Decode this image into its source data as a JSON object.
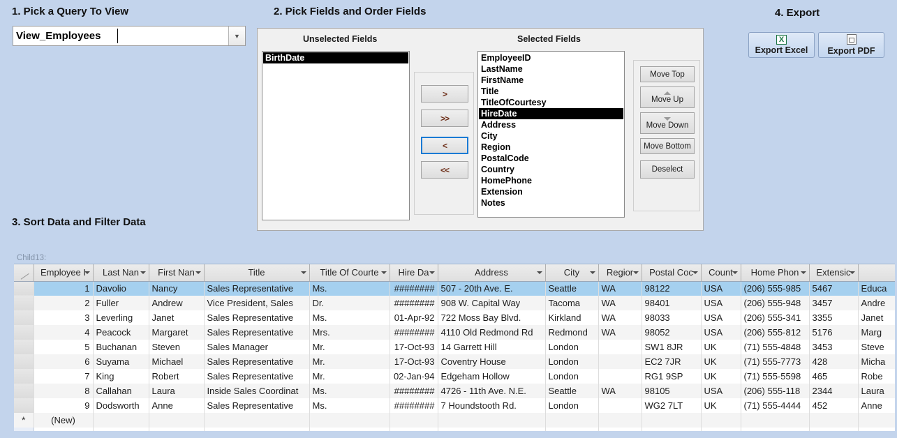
{
  "sections": {
    "step1": "1. Pick a Query To View",
    "step2": "2. Pick Fields and Order Fields",
    "step3": "3. Sort Data and Filter Data",
    "step4": "4. Export"
  },
  "query_combo": {
    "value": "View_Employees",
    "placeholder": "",
    "arrow_icon": "chevron-down-icon"
  },
  "fields": {
    "unselected_label": "Unselected Fields",
    "selected_label": "Selected Fields",
    "unselected": [
      {
        "label": "BirthDate",
        "selected": true
      }
    ],
    "selected": [
      {
        "label": "EmployeeID",
        "selected": false
      },
      {
        "label": "LastName",
        "selected": false
      },
      {
        "label": "FirstName",
        "selected": false
      },
      {
        "label": "Title",
        "selected": false
      },
      {
        "label": "TitleOfCourtesy",
        "selected": false
      },
      {
        "label": "HireDate",
        "selected": true
      },
      {
        "label": "Address",
        "selected": false
      },
      {
        "label": "City",
        "selected": false
      },
      {
        "label": "Region",
        "selected": false
      },
      {
        "label": "PostalCode",
        "selected": false
      },
      {
        "label": "Country",
        "selected": false
      },
      {
        "label": "HomePhone",
        "selected": false
      },
      {
        "label": "Extension",
        "selected": false
      },
      {
        "label": "Notes",
        "selected": false
      }
    ],
    "transfer_buttons": {
      "move_right_one": ">",
      "move_right_all": ">>",
      "move_left_one": "<",
      "move_left_all": "<<",
      "focused": "<"
    },
    "order_buttons": {
      "move_top": "Move Top",
      "move_up": "Move Up",
      "move_down": "Move Down",
      "move_bottom": "Move Bottom",
      "deselect": "Deselect"
    }
  },
  "export": {
    "excel_label": "Export Excel",
    "excel_icon": "excel-file-icon",
    "excel_icon_glyph": "X",
    "pdf_label": "Export PDF",
    "pdf_icon": "pdf-file-icon"
  },
  "datasheet": {
    "child_label": "Child13:",
    "new_record_label": "(New)",
    "new_record_icon": "asterisk-icon",
    "columns": [
      "Employee I",
      "Last Nan",
      "First Nan",
      "Title",
      "Title Of Courte",
      "Hire Da",
      "Address",
      "City",
      "Regior",
      "Postal Coc",
      "Count",
      "Home Phon",
      "Extensic",
      ""
    ],
    "rows": [
      {
        "selected": true,
        "id": "1",
        "last": "Davolio",
        "first": "Nancy",
        "title": "Sales Representative",
        "courtesy": "Ms.",
        "hire": "########",
        "address": "507 - 20th Ave. E.",
        "city": "Seattle",
        "region": "WA",
        "postal": "98122",
        "country": "USA",
        "phone": "(206) 555-985",
        "ext": "5467",
        "notes": "Educa"
      },
      {
        "selected": false,
        "id": "2",
        "last": "Fuller",
        "first": "Andrew",
        "title": "Vice President, Sales",
        "courtesy": "Dr.",
        "hire": "########",
        "address": "908 W. Capital Way",
        "city": "Tacoma",
        "region": "WA",
        "postal": "98401",
        "country": "USA",
        "phone": "(206) 555-948",
        "ext": "3457",
        "notes": "Andre"
      },
      {
        "selected": false,
        "id": "3",
        "last": "Leverling",
        "first": "Janet",
        "title": "Sales Representative",
        "courtesy": "Ms.",
        "hire": "01-Apr-92",
        "address": "722 Moss Bay Blvd.",
        "city": "Kirkland",
        "region": "WA",
        "postal": "98033",
        "country": "USA",
        "phone": "(206) 555-341",
        "ext": "3355",
        "notes": "Janet"
      },
      {
        "selected": false,
        "id": "4",
        "last": "Peacock",
        "first": "Margaret",
        "title": "Sales Representative",
        "courtesy": "Mrs.",
        "hire": "########",
        "address": "4110 Old Redmond Rd",
        "city": "Redmond",
        "region": "WA",
        "postal": "98052",
        "country": "USA",
        "phone": "(206) 555-812",
        "ext": "5176",
        "notes": "Marg"
      },
      {
        "selected": false,
        "id": "5",
        "last": "Buchanan",
        "first": "Steven",
        "title": "Sales Manager",
        "courtesy": "Mr.",
        "hire": "17-Oct-93",
        "address": "14 Garrett Hill",
        "city": "London",
        "region": "",
        "postal": "SW1 8JR",
        "country": "UK",
        "phone": "(71) 555-4848",
        "ext": "3453",
        "notes": "Steve"
      },
      {
        "selected": false,
        "id": "6",
        "last": "Suyama",
        "first": "Michael",
        "title": "Sales Representative",
        "courtesy": "Mr.",
        "hire": "17-Oct-93",
        "address": "Coventry House",
        "city": "London",
        "region": "",
        "postal": "EC2 7JR",
        "country": "UK",
        "phone": "(71) 555-7773",
        "ext": "428",
        "notes": "Micha"
      },
      {
        "selected": false,
        "id": "7",
        "last": "King",
        "first": "Robert",
        "title": "Sales Representative",
        "courtesy": "Mr.",
        "hire": "02-Jan-94",
        "address": "Edgeham Hollow",
        "city": "London",
        "region": "",
        "postal": "RG1 9SP",
        "country": "UK",
        "phone": "(71) 555-5598",
        "ext": "465",
        "notes": "Robe"
      },
      {
        "selected": false,
        "id": "8",
        "last": "Callahan",
        "first": "Laura",
        "title": "Inside Sales Coordinat",
        "courtesy": "Ms.",
        "hire": "########",
        "address": "4726 - 11th Ave. N.E.",
        "city": "Seattle",
        "region": "WA",
        "postal": "98105",
        "country": "USA",
        "phone": "(206) 555-118",
        "ext": "2344",
        "notes": "Laura"
      },
      {
        "selected": false,
        "id": "9",
        "last": "Dodsworth",
        "first": "Anne",
        "title": "Sales Representative",
        "courtesy": "Ms.",
        "hire": "########",
        "address": "7 Houndstooth Rd.",
        "city": "London",
        "region": "",
        "postal": "WG2 7LT",
        "country": "UK",
        "phone": "(71) 555-4444",
        "ext": "452",
        "notes": "Anne"
      }
    ]
  },
  "colors": {
    "background": "#c3d4ec",
    "row_selected": "#a5d0ef",
    "list_selected": "#000000",
    "focus_border": "#1a7ad4",
    "excel_green": "#1d7544"
  }
}
